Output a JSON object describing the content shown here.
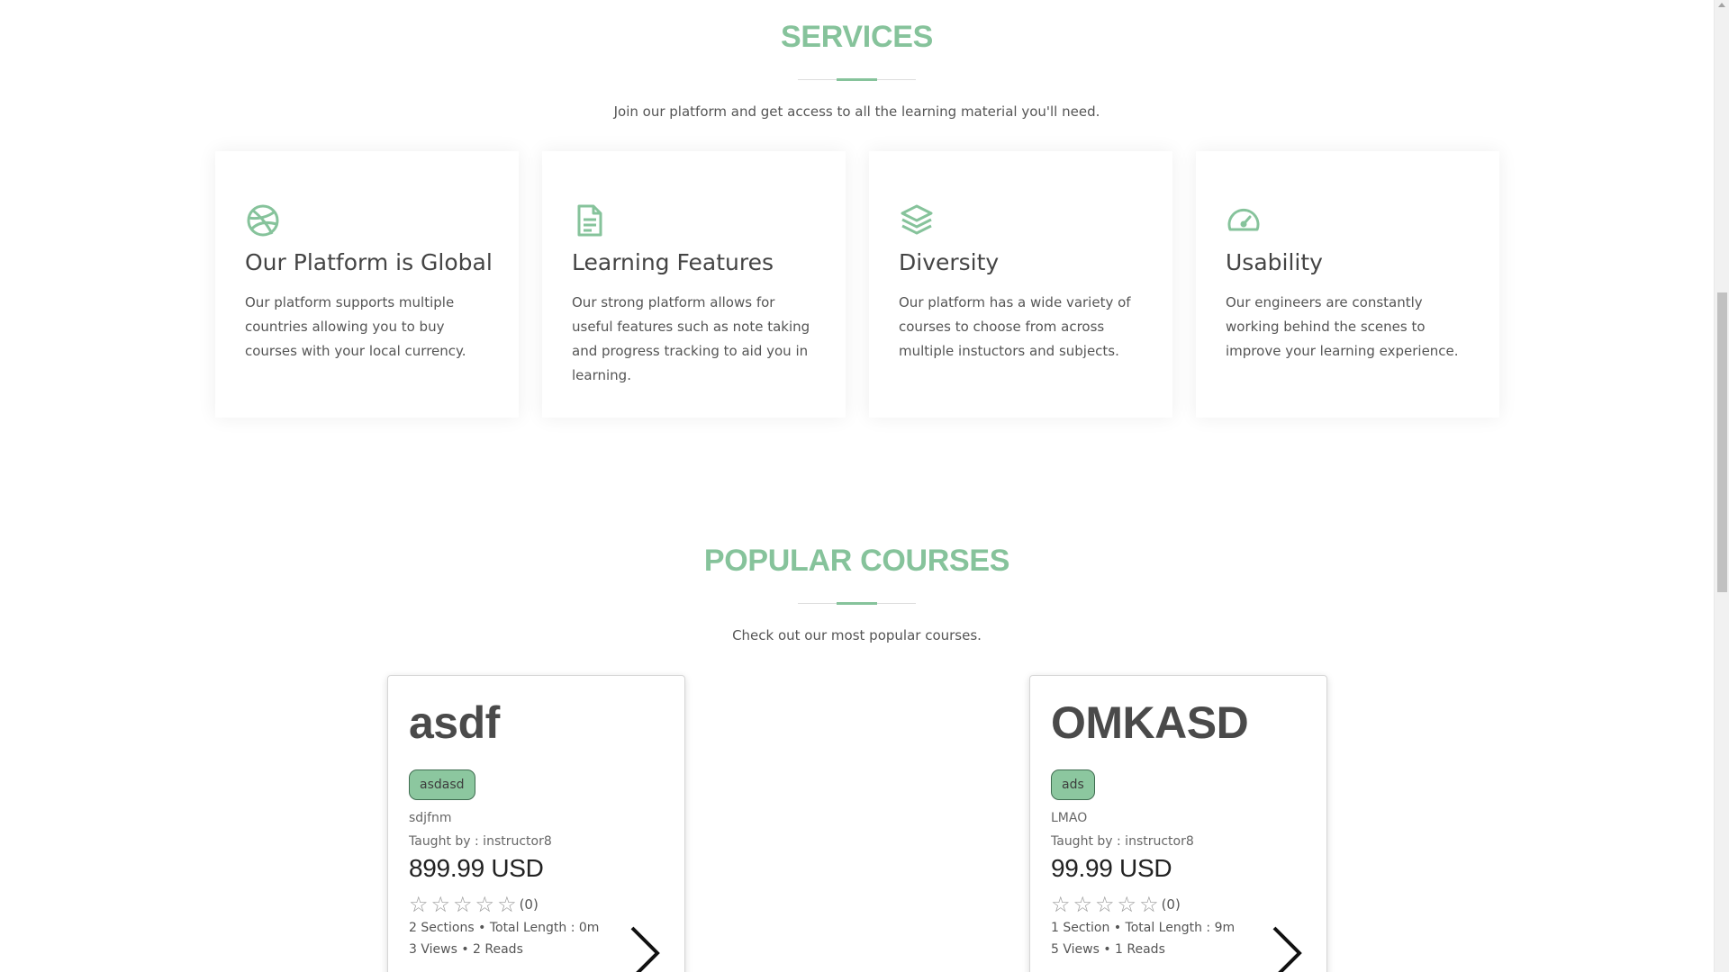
{
  "colors": {
    "accent": "#86c39b",
    "tag_bg": "#8cc79f",
    "tag_border": "#3f6c50"
  },
  "services": {
    "title": "SERVICES",
    "subtitle": "Join our platform and get access to all the learning material you'll need.",
    "cards": [
      {
        "icon": "dribbble-icon",
        "title": "Our Platform is Global",
        "text": "Our platform supports multiple countries allowing you to buy courses with your local currency."
      },
      {
        "icon": "document-icon",
        "title": "Learning Features",
        "text": "Our strong platform allows for useful features such as note taking and progress tracking to aid you in learning."
      },
      {
        "icon": "layers-icon",
        "title": "Diversity",
        "text": "Our platform has a wide variety of courses to choose from across multiple instuctors and subjects."
      },
      {
        "icon": "speedometer-icon",
        "title": "Usability",
        "text": "Our engineers are constantly working behind the scenes to improve your learning experience."
      }
    ]
  },
  "popular": {
    "title": "POPULAR COURSES",
    "subtitle": "Check out our most popular courses.",
    "courses": [
      {
        "title": "asdf",
        "tag": "asdasd",
        "description": "sdjfnm",
        "teacher": "Taught by : instructor8",
        "price": "899.99 USD",
        "stars": 0,
        "rating_count": "(0)",
        "meta": "2 Sections • Total Length : 0m",
        "meta2": "3 Views • 2 Reads"
      },
      {
        "title": "OMKASD",
        "tag": "ads",
        "description": "LMAO",
        "teacher": "Taught by : instructor8",
        "price": "99.99 USD",
        "stars": 0,
        "rating_count": "(0)",
        "meta": "1 Section • Total Length : 9m",
        "meta2": "5 Views • 1 Reads"
      }
    ]
  }
}
